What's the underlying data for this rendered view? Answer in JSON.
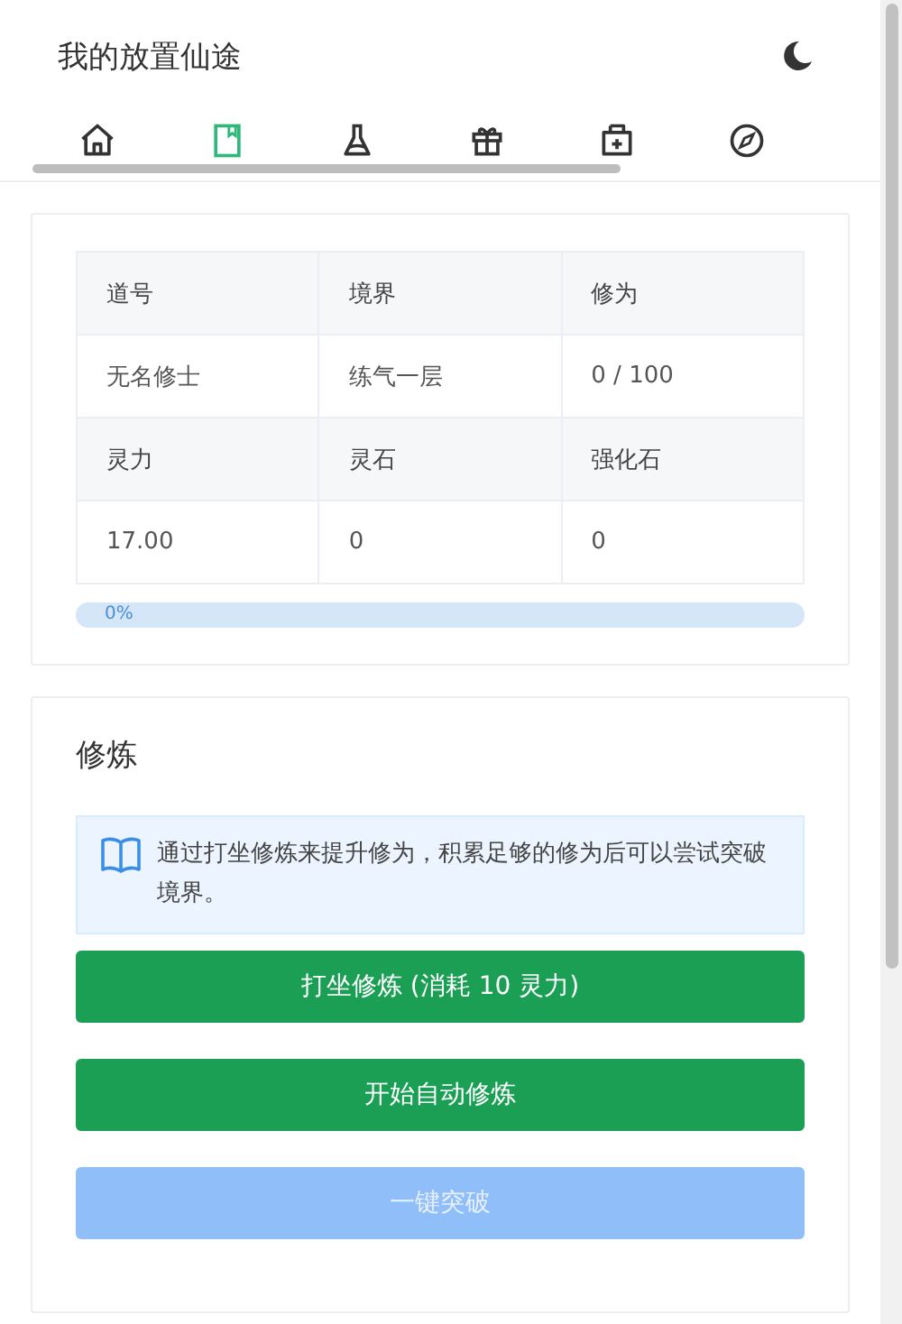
{
  "header": {
    "title": "我的放置仙途"
  },
  "tabs": [
    {
      "selected": false
    },
    {
      "selected": true
    },
    {
      "selected": false
    },
    {
      "selected": false
    },
    {
      "selected": false
    },
    {
      "selected": false
    }
  ],
  "stats": {
    "rows": [
      {
        "kind": "label",
        "cells": [
          "道号",
          "境界",
          "修为"
        ]
      },
      {
        "kind": "value",
        "cells": [
          "无名修士",
          "练气一层",
          "0 / 100"
        ]
      },
      {
        "kind": "label",
        "cells": [
          "灵力",
          "灵石",
          "强化石"
        ]
      },
      {
        "kind": "value",
        "cells": [
          "17.00",
          "0",
          "0"
        ]
      }
    ],
    "progress": {
      "level": 0,
      "label": "0%"
    }
  },
  "cultivation": {
    "title": "修炼",
    "notice": "通过打坐修炼来提升修为，积累足够的修为后可以尝试突破境界。",
    "buttons": [
      {
        "label": "打坐修炼 (消耗 10 灵力)",
        "disabled": false
      },
      {
        "label": "开始自动修炼",
        "disabled": false
      },
      {
        "label": "一键突破",
        "disabled": true
      }
    ]
  }
}
